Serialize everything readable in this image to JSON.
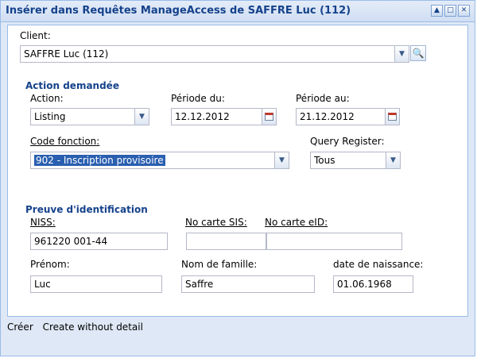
{
  "window": {
    "title": "Insérer dans Requêtes ManageAccess de SAFFRE Luc (112)"
  },
  "client": {
    "label": "Client:",
    "value": "SAFFRE Luc (112)"
  },
  "action_section": {
    "title": "Action demandée",
    "action_label": "Action:",
    "action_value": "Listing",
    "periode_du_label": "Période du:",
    "periode_du_value": "12.12.2012",
    "periode_au_label": "Période au:",
    "periode_au_value": "21.12.2012",
    "code_fonction_label": "Code fonction:",
    "code_fonction_value": "902 - Inscription provisoire",
    "query_register_label": "Query Register:",
    "query_register_value": "Tous"
  },
  "identification": {
    "title": "Preuve d'identification",
    "niss_label": "NISS:",
    "niss_value": "961220 001-44",
    "carte_sis_label": "No carte SIS:",
    "carte_sis_value": "",
    "carte_eid_label": "No carte eID:",
    "carte_eid_value": "",
    "prenom_label": "Prénom:",
    "prenom_value": "Luc",
    "nom_label": "Nom de famille:",
    "nom_value": "Saffre",
    "naissance_label": "date de naissance:",
    "naissance_value": "01.06.1968"
  },
  "footer": {
    "create_label": "Créer",
    "create_without_detail_label": "Create without detail"
  }
}
